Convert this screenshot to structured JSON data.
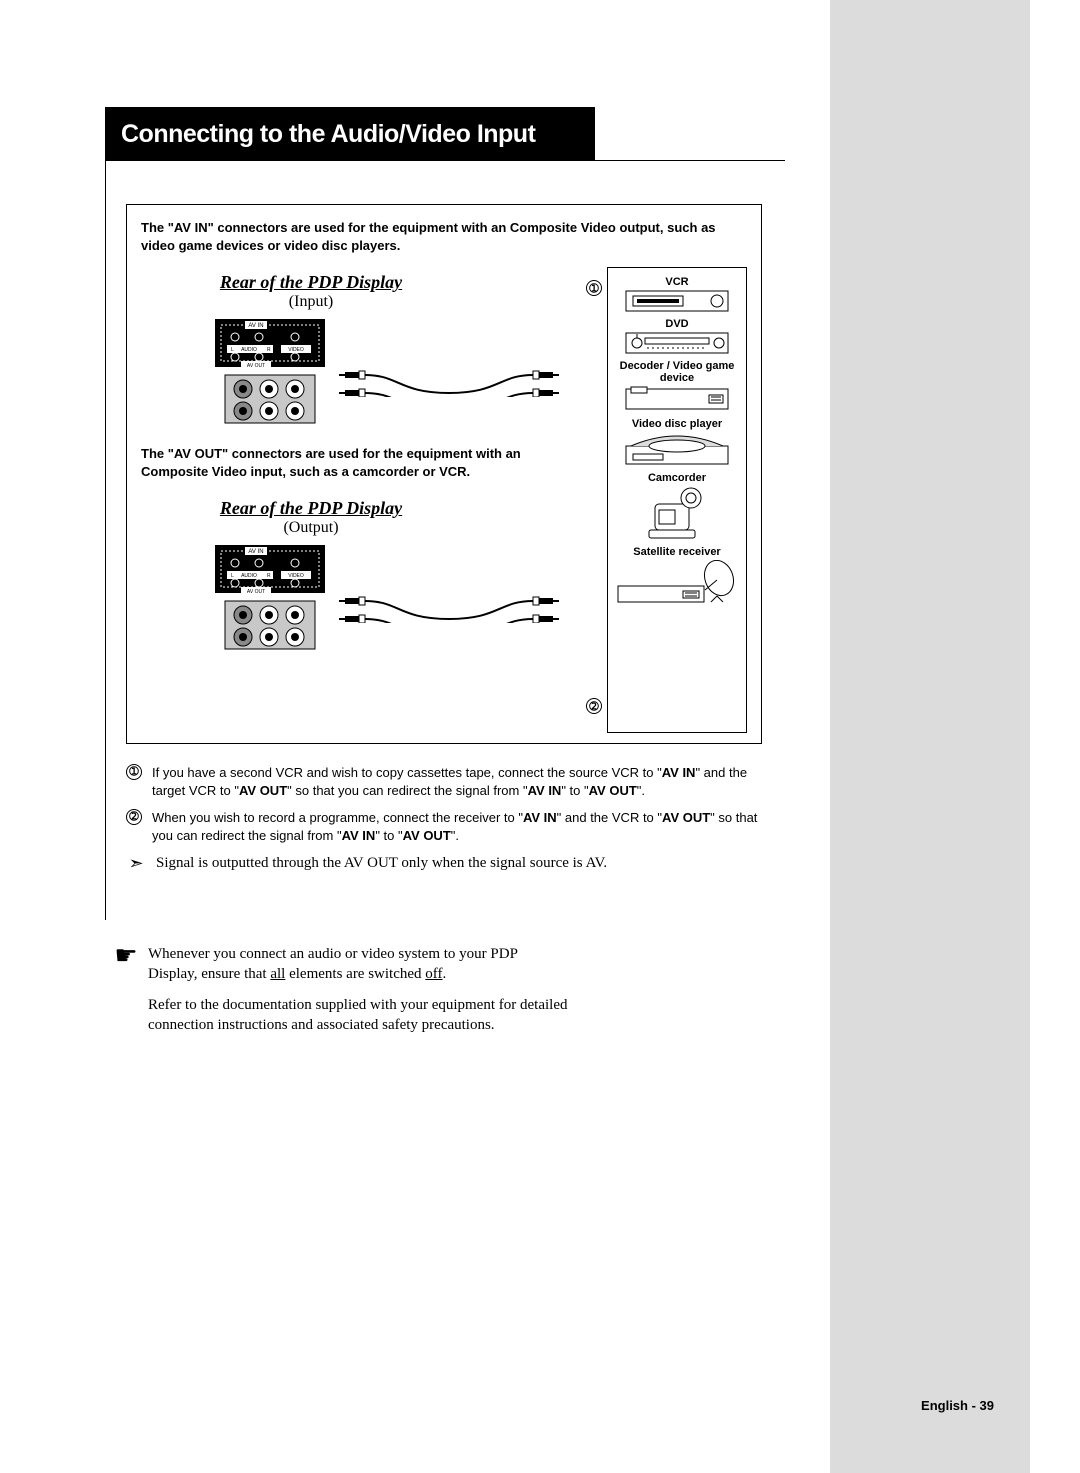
{
  "title": "Connecting to the Audio/Video Input",
  "intro": "The \"AV IN\" connectors are used for the equipment with an Composite Video output, such as video game devices or video disc players.",
  "section_input": {
    "title": "Rear of the PDP Display",
    "sub": "(Input)"
  },
  "mid_para": "The \"AV OUT\" connectors are used for the equipment with an Composite Video input, such as a camcorder or VCR.",
  "section_output": {
    "title": "Rear of the PDP Display",
    "sub": "(Output)"
  },
  "devices": {
    "vcr": "VCR",
    "dvd": "DVD",
    "decoder": "Decoder / Video game device",
    "disc": "Video disc player",
    "camcorder": "Camcorder",
    "sat": "Satellite receiver"
  },
  "marker1": "➀",
  "marker2": "➁",
  "note1_pre": "If you have a second VCR and wish to copy cassettes tape, connect the source VCR to \"",
  "note1_b1": "AV IN",
  "note1_mid1": "\" and the target VCR to \"",
  "note1_b2": "AV OUT",
  "note1_mid2": "\" so that you can redirect the signal from \"",
  "note1_b3": "AV IN",
  "note1_mid3": "\" to \"",
  "note1_b4": "AV OUT",
  "note1_end": "\".",
  "note2_pre": "When you wish to record a programme, connect the receiver to \"",
  "note2_b1": "AV IN",
  "note2_mid1": "\" and the VCR to \"",
  "note2_b2": "AV OUT",
  "note2_mid2": "\" so that you can redirect the signal from \"",
  "note2_b3": "AV IN",
  "note2_mid3": "\" to \"",
  "note2_b4": "AV OUT",
  "note2_end": "\".",
  "arrow_note": "Signal is outputted through the AV OUT only when the signal source is AV.",
  "bottom1_pre": "Whenever you connect an audio or video system to your PDP Display, ensure that ",
  "bottom1_u1": "all",
  "bottom1_mid": " elements are switched ",
  "bottom1_u2": "off",
  "bottom1_end": ".",
  "bottom2": "Refer to the documentation supplied with your equipment for detailed connection instructions and associated safety precautions.",
  "footer": "English - 39",
  "panel_labels": {
    "avin": "AV IN",
    "avout": "AV OUT",
    "audio": "AUDIO",
    "video": "VIDEO",
    "l": "L",
    "r": "R"
  }
}
